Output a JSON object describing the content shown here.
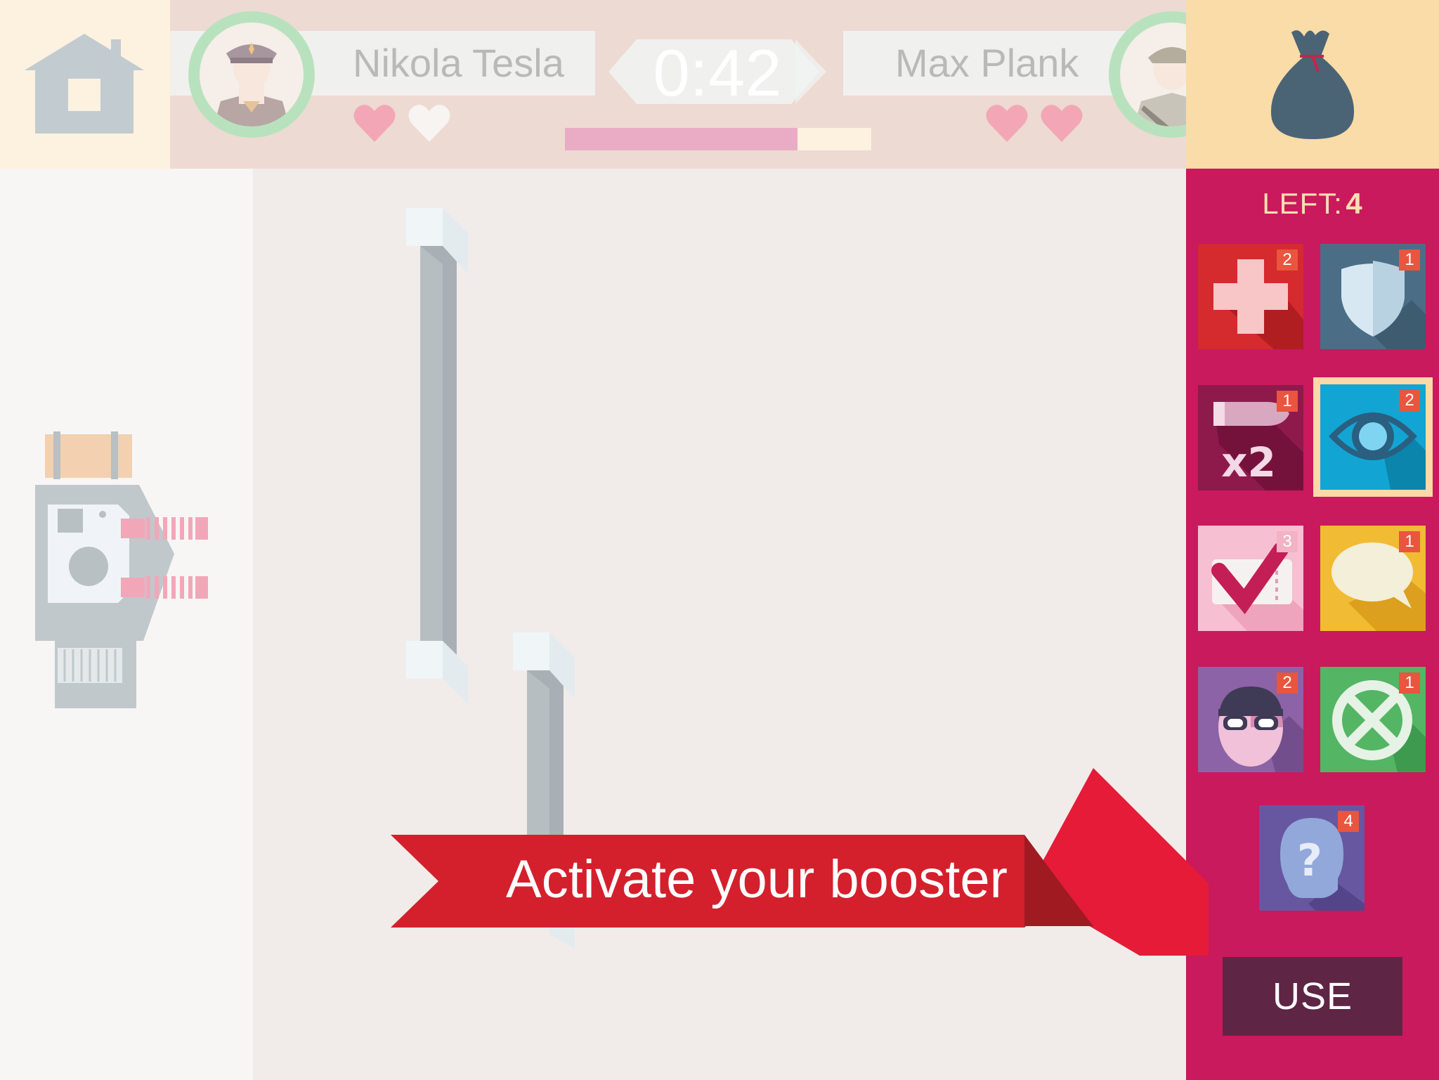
{
  "header": {
    "player_left": {
      "name": "Nikola Tesla",
      "hearts_full": 1,
      "hearts_total": 2
    },
    "player_right": {
      "name": "Max Plank",
      "hearts_full": 2,
      "hearts_total": 2
    },
    "timer": "0:42",
    "timer_progress": 0.76
  },
  "icons": {
    "home": "home-icon",
    "bag": "money-bag-icon"
  },
  "boosters": {
    "left_label": "LEFT:",
    "left_count": "4",
    "items": [
      {
        "name": "health",
        "count": "2",
        "color": "#d52a2e"
      },
      {
        "name": "shield",
        "count": "1",
        "color": "#4b6e86"
      },
      {
        "name": "double-damage",
        "count": "1",
        "color": "#8e1a4c",
        "label": "x2"
      },
      {
        "name": "eye",
        "count": "2",
        "color": "#12a5d4",
        "selected": true
      },
      {
        "name": "ticket-check",
        "count": "3",
        "color": "#f6bfd2"
      },
      {
        "name": "speech-bubble",
        "count": "1",
        "color": "#f2bb34"
      },
      {
        "name": "thief",
        "count": "2",
        "color": "#8c63a6"
      },
      {
        "name": "cross-circle",
        "count": "1",
        "color": "#54b564"
      },
      {
        "name": "mystery",
        "count": "4",
        "color": "#6757a0"
      }
    ],
    "use_label": "USE"
  },
  "tooltip": {
    "text": "Activate your booster"
  },
  "colors": {
    "panel": "#c81a5c",
    "ribbon": "#d4202c",
    "ribbon_dark": "#e51b38"
  }
}
